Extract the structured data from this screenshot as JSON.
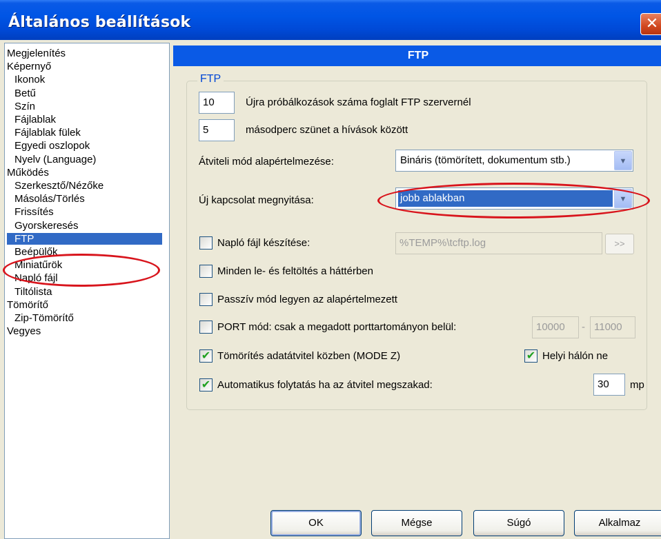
{
  "window": {
    "title": "Általános beállítások",
    "close_glyph": "✕"
  },
  "tree": {
    "items": [
      {
        "label": "Megjelenítés",
        "level": 0
      },
      {
        "label": "Képernyő",
        "level": 0
      },
      {
        "label": "Ikonok",
        "level": 1
      },
      {
        "label": "Betű",
        "level": 1
      },
      {
        "label": "Szín",
        "level": 1
      },
      {
        "label": "Fájlablak",
        "level": 1
      },
      {
        "label": "Fájlablak fülek",
        "level": 1
      },
      {
        "label": "Egyedi oszlopok",
        "level": 1
      },
      {
        "label": "Nyelv (Language)",
        "level": 1
      },
      {
        "label": "Működés",
        "level": 0
      },
      {
        "label": "Szerkesztő/Nézőke",
        "level": 1
      },
      {
        "label": "Másolás/Törlés",
        "level": 1
      },
      {
        "label": "Frissítés",
        "level": 1
      },
      {
        "label": "Gyorskeresés",
        "level": 1
      },
      {
        "label": "FTP",
        "level": 1,
        "selected": true
      },
      {
        "label": "Beépülők",
        "level": 1
      },
      {
        "label": "Miniatűrök",
        "level": 1
      },
      {
        "label": "Napló fájl",
        "level": 1
      },
      {
        "label": "Tiltólista",
        "level": 1
      },
      {
        "label": "Tömörítő",
        "level": 0
      },
      {
        "label": "Zip-Tömörítő",
        "level": 1
      },
      {
        "label": "Vegyes",
        "level": 0
      }
    ]
  },
  "panel": {
    "header": "FTP",
    "group_title": "FTP",
    "retries": {
      "value": "10",
      "label": "Újra próbálkozások száma foglalt FTP szervernél"
    },
    "pause": {
      "value": "5",
      "label": "másodperc szünet a hívások között"
    },
    "transfer_mode": {
      "label": "Átviteli mód alapértelmezése:",
      "value": "Bináris (tömörített, dokumentum stb.)"
    },
    "new_connection": {
      "label": "Új kapcsolat megnyitása:",
      "value": "jobb ablakban"
    },
    "log_file": {
      "label": "Napló fájl készítése:",
      "checked": false,
      "path": "%TEMP%\\tcftp.log",
      "browse": ">>"
    },
    "background": {
      "label": "Minden le- és feltöltés a háttérben",
      "checked": false
    },
    "passive": {
      "label": "Passzív mód legyen az alapértelmezett",
      "checked": false
    },
    "port": {
      "label": "PORT mód: csak a megadott porttartományon belül:",
      "checked": false,
      "from": "10000",
      "dash": "-",
      "to": "11000"
    },
    "compression": {
      "label": "Tömörítés adatátvitel közben (MODE Z)",
      "checked": true
    },
    "local_network": {
      "label": "Helyi hálón ne",
      "checked": true
    },
    "auto_resume": {
      "label": "Automatikus folytatás ha az átvitel megszakad:",
      "checked": true,
      "value": "30",
      "unit": "mp"
    }
  },
  "buttons": {
    "ok": "OK",
    "cancel": "Mégse",
    "help": "Súgó",
    "apply": "Alkalmaz"
  },
  "colors": {
    "titlebar": "#0055e5",
    "selection": "#316ac5",
    "annotation": "#d8141c",
    "checkmark": "#21a121"
  }
}
